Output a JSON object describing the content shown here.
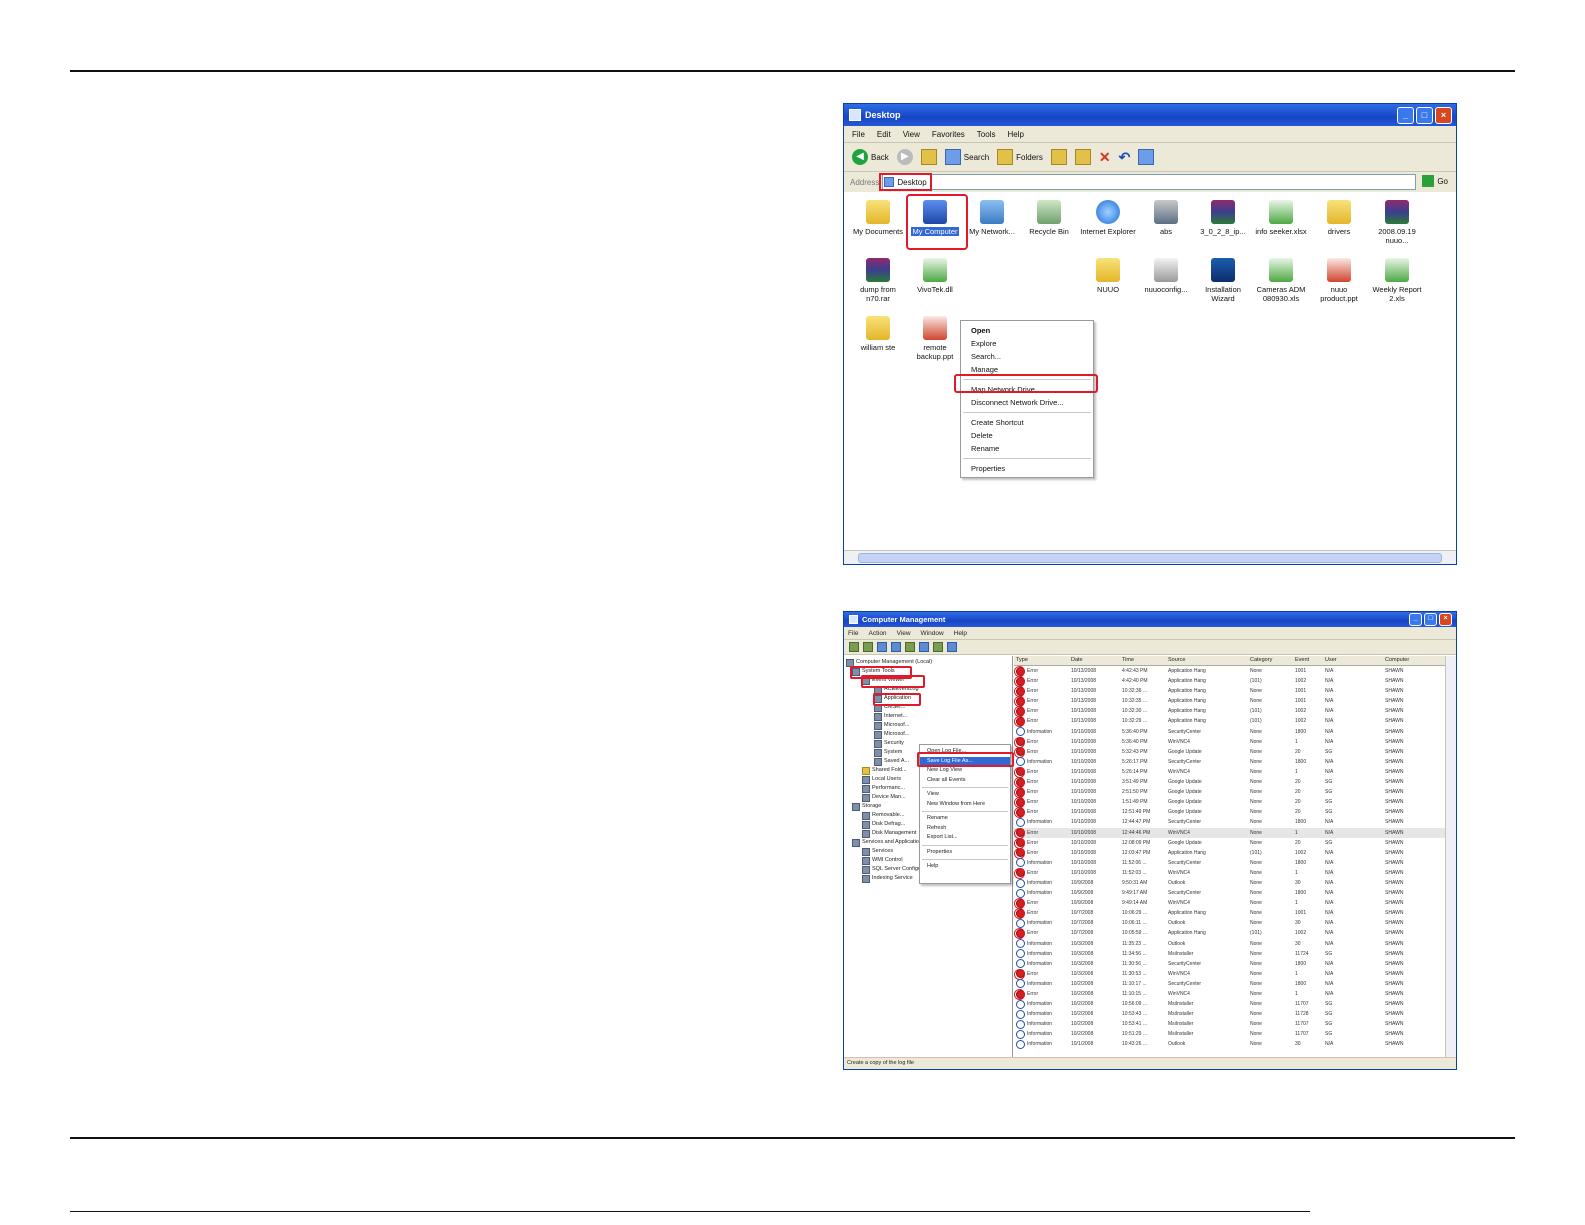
{
  "explorer": {
    "title": "Desktop",
    "menu": [
      "File",
      "Edit",
      "View",
      "Favorites",
      "Tools",
      "Help"
    ],
    "toolbar": {
      "back": "Back",
      "search": "Search",
      "folders": "Folders"
    },
    "address_label": "Address",
    "address_value": "Desktop",
    "go_label": "Go",
    "icons": [
      {
        "label": "My Documents",
        "kind": "folder"
      },
      {
        "label": "My Computer",
        "kind": "comp"
      },
      {
        "label": "My Network...",
        "kind": "net"
      },
      {
        "label": "Recycle Bin",
        "kind": "bin"
      },
      {
        "label": "Internet Explorer",
        "kind": "ie"
      },
      {
        "label": "abs",
        "kind": "abs"
      },
      {
        "label": "3_0_2_8_ip...",
        "kind": "rar"
      },
      {
        "label": "info seeker.xlsx",
        "kind": "xls"
      },
      {
        "label": "drivers",
        "kind": "folder"
      },
      {
        "label": "2008.09.19 nuuo...",
        "kind": "rar"
      },
      {
        "label": "dump from n70.rar",
        "kind": "rar"
      },
      {
        "label": "VivoTek.dll",
        "kind": "xls"
      },
      {
        "label": "NUUO",
        "kind": "folder"
      },
      {
        "label": "nuuoconfig...",
        "kind": "cfg"
      },
      {
        "label": "Installation Wizard",
        "kind": "inst"
      },
      {
        "label": "Cameras ADM 080930.xls",
        "kind": "xls"
      },
      {
        "label": "nuuo product.ppt",
        "kind": "ppt"
      },
      {
        "label": "Weekly Report 2.xls",
        "kind": "xls"
      },
      {
        "label": "william ste",
        "kind": "folder"
      },
      {
        "label": "remote backup.ppt",
        "kind": "ppt"
      }
    ],
    "context_menu": [
      "Open",
      "Explore",
      "Search...",
      "Manage",
      "Map Network Drive...",
      "Disconnect Network Drive...",
      "Create Shortcut",
      "Delete",
      "Rename",
      "Properties"
    ]
  },
  "compmgmt": {
    "title": "Computer Management",
    "menu": [
      "File",
      "Action",
      "View",
      "Window",
      "Help"
    ],
    "tree": [
      "Computer Management (Local)",
      "System Tools",
      "Event Viewer",
      "ACEEventLog",
      "Application",
      "CMSer...",
      "Internet...",
      "Microsof...",
      "Microsof...",
      "Security",
      "System",
      "Saved A...",
      "Shared Fold...",
      "Local Users",
      "Performanc...",
      "Device Man...",
      "Storage",
      "Removable...",
      "Disk Defrag...",
      "Disk Management",
      "Services and Applications",
      "Services",
      "WMI Control",
      "SQL Server Configuration Manager",
      "Indexing Service"
    ],
    "context_menu": [
      "Open Log File...",
      "Save Log File As...",
      "New Log View",
      "Clear all Events",
      "View",
      "New Window from Here",
      "Rename",
      "Refresh",
      "Export List...",
      "Properties",
      "Help"
    ],
    "columns": [
      "Type",
      "Date",
      "Time",
      "Source",
      "Category",
      "Event",
      "User",
      "Computer"
    ],
    "rows": [
      [
        "Error",
        "10/13/2008",
        "4:42:43 PM",
        "Application Hang",
        "None",
        "1001",
        "N/A",
        "SHAWN"
      ],
      [
        "Error",
        "10/13/2008",
        "4:42:40 PM",
        "Application Hang",
        "(101)",
        "1002",
        "N/A",
        "SHAWN"
      ],
      [
        "Error",
        "10/13/2008",
        "10:32:36 ...",
        "Application Hang",
        "None",
        "1001",
        "N/A",
        "SHAWN"
      ],
      [
        "Error",
        "10/13/2008",
        "10:32:35 ...",
        "Application Hang",
        "None",
        "1001",
        "N/A",
        "SHAWN"
      ],
      [
        "Error",
        "10/13/2008",
        "10:32:30 ...",
        "Application Hang",
        "(101)",
        "1002",
        "N/A",
        "SHAWN"
      ],
      [
        "Error",
        "10/13/2008",
        "10:32:29 ...",
        "Application Hang",
        "(101)",
        "1002",
        "N/A",
        "SHAWN"
      ],
      [
        "Information",
        "10/10/2008",
        "5:36:40 PM",
        "SecurityCenter",
        "None",
        "1800",
        "N/A",
        "SHAWN"
      ],
      [
        "Error",
        "10/10/2008",
        "5:36:40 PM",
        "WinVNC4",
        "None",
        "1",
        "N/A",
        "SHAWN"
      ],
      [
        "Error",
        "10/10/2008",
        "5:32:43 PM",
        "Google Update",
        "None",
        "20",
        "SG",
        "SHAWN"
      ],
      [
        "Information",
        "10/10/2008",
        "5:26:17 PM",
        "SecurityCenter",
        "None",
        "1800",
        "N/A",
        "SHAWN"
      ],
      [
        "Error",
        "10/10/2008",
        "5:26:14 PM",
        "WinVNC4",
        "None",
        "1",
        "N/A",
        "SHAWN"
      ],
      [
        "Error",
        "10/10/2008",
        "3:51:49 PM",
        "Google Update",
        "None",
        "20",
        "SG",
        "SHAWN"
      ],
      [
        "Error",
        "10/10/2008",
        "2:51:50 PM",
        "Google Update",
        "None",
        "20",
        "SG",
        "SHAWN"
      ],
      [
        "Error",
        "10/10/2008",
        "1:51:49 PM",
        "Google Update",
        "None",
        "20",
        "SG",
        "SHAWN"
      ],
      [
        "Error",
        "10/10/2008",
        "12:51:49 PM",
        "Google Update",
        "None",
        "20",
        "SG",
        "SHAWN"
      ],
      [
        "Information",
        "10/10/2008",
        "12:44:47 PM",
        "SecurityCenter",
        "None",
        "1800",
        "N/A",
        "SHAWN"
      ],
      [
        "Error",
        "10/10/2008",
        "12:44:46 PM",
        "WinVNC4",
        "None",
        "1",
        "N/A",
        "SHAWN"
      ],
      [
        "Error",
        "10/10/2008",
        "12:08:09 PM",
        "Google Update",
        "None",
        "20",
        "SG",
        "SHAWN"
      ],
      [
        "Error",
        "10/10/2008",
        "12:03:47 PM",
        "Application Hang",
        "(101)",
        "1002",
        "N/A",
        "SHAWN"
      ],
      [
        "Information",
        "10/10/2008",
        "11:52:06 ...",
        "SecurityCenter",
        "None",
        "1800",
        "N/A",
        "SHAWN"
      ],
      [
        "Error",
        "10/10/2008",
        "11:52:03 ...",
        "WinVNC4",
        "None",
        "1",
        "N/A",
        "SHAWN"
      ],
      [
        "Information",
        "10/9/2008",
        "9:50:31 AM",
        "Outlook",
        "None",
        "30",
        "N/A",
        "SHAWN"
      ],
      [
        "Information",
        "10/9/2008",
        "9:49:17 AM",
        "SecurityCenter",
        "None",
        "1800",
        "N/A",
        "SHAWN"
      ],
      [
        "Error",
        "10/9/2008",
        "9:49:14 AM",
        "WinVNC4",
        "None",
        "1",
        "N/A",
        "SHAWN"
      ],
      [
        "Error",
        "10/7/2008",
        "10:06:29 ...",
        "Application Hang",
        "None",
        "1001",
        "N/A",
        "SHAWN"
      ],
      [
        "Information",
        "10/7/2008",
        "10:06:11 ...",
        "Outlook",
        "None",
        "30",
        "N/A",
        "SHAWN"
      ],
      [
        "Error",
        "10/7/2008",
        "10:05:59 ...",
        "Application Hang",
        "(101)",
        "1002",
        "N/A",
        "SHAWN"
      ],
      [
        "Information",
        "10/3/2008",
        "11:35:23 ...",
        "Outlook",
        "None",
        "30",
        "N/A",
        "SHAWN"
      ],
      [
        "Information",
        "10/3/2008",
        "11:34:56 ...",
        "MsiInstaller",
        "None",
        "11724",
        "SG",
        "SHAWN"
      ],
      [
        "Information",
        "10/3/2008",
        "11:30:56 ...",
        "SecurityCenter",
        "None",
        "1800",
        "N/A",
        "SHAWN"
      ],
      [
        "Error",
        "10/3/2008",
        "11:30:53 ...",
        "WinVNC4",
        "None",
        "1",
        "N/A",
        "SHAWN"
      ],
      [
        "Information",
        "10/2/2008",
        "11:10:17 ...",
        "SecurityCenter",
        "None",
        "1800",
        "N/A",
        "SHAWN"
      ],
      [
        "Error",
        "10/2/2008",
        "11:10:15 ...",
        "WinVNC4",
        "None",
        "1",
        "N/A",
        "SHAWN"
      ],
      [
        "Information",
        "10/2/2008",
        "10:56:09 ...",
        "MsiInstaller",
        "None",
        "11707",
        "SG",
        "SHAWN"
      ],
      [
        "Information",
        "10/2/2008",
        "10:53:43 ...",
        "MsiInstaller",
        "None",
        "11728",
        "SG",
        "SHAWN"
      ],
      [
        "Information",
        "10/2/2008",
        "10:53:41 ...",
        "MsiInstaller",
        "None",
        "11707",
        "SG",
        "SHAWN"
      ],
      [
        "Information",
        "10/2/2008",
        "10:51:29 ...",
        "MsiInstaller",
        "None",
        "11707",
        "SG",
        "SHAWN"
      ],
      [
        "Information",
        "10/1/2008",
        "10:43:26 ...",
        "Outlook",
        "None",
        "30",
        "N/A",
        "SHAWN"
      ]
    ],
    "status": "Create a copy of the log file"
  }
}
